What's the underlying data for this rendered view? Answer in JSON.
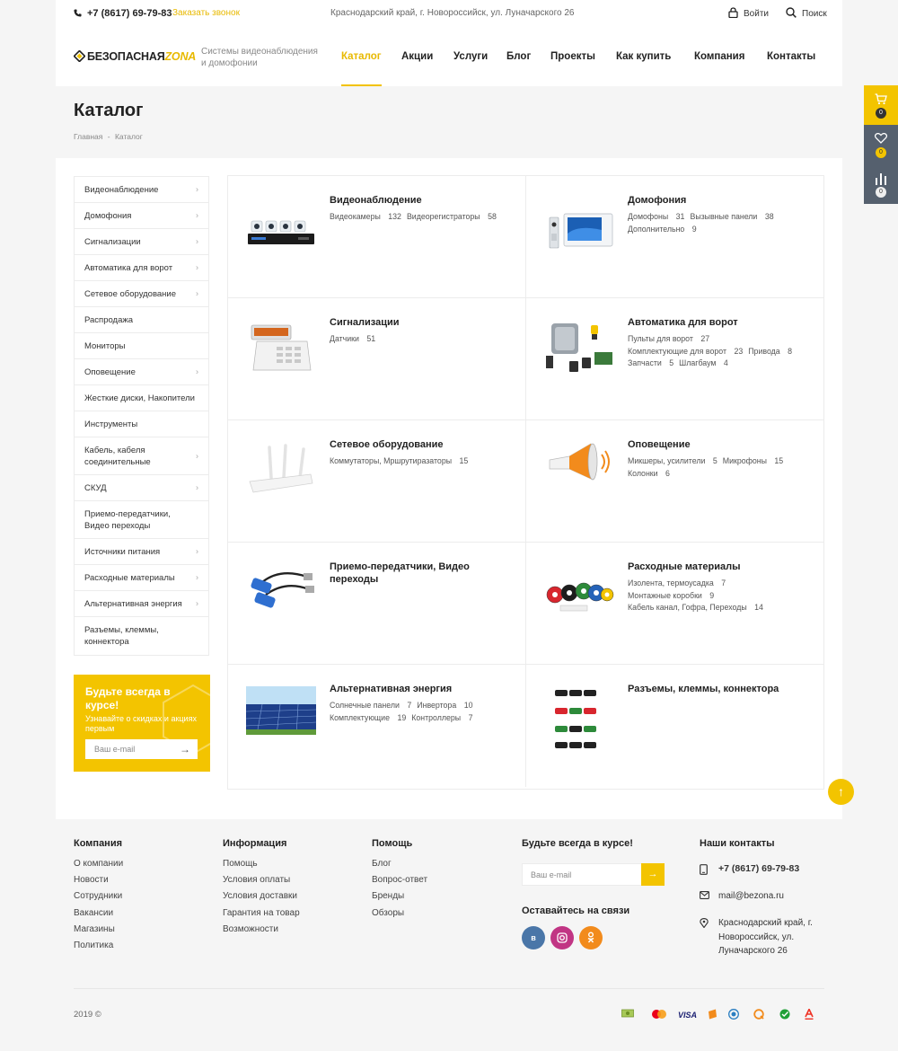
{
  "topbar": {
    "phone": "+7 (8617) 69-79-83",
    "callback": "Заказать звонок",
    "address": "Краснодарский край, г. Новороссийск, ул. Луначарского 26",
    "login": "Войти",
    "search": "Поиск"
  },
  "header": {
    "logo_main": "БЕЗОПАСНАЯ",
    "logo_accent": "ZONA",
    "tagline": "Системы видеонаблюдения и домофонии",
    "nav": [
      "Каталог",
      "Акции",
      "Услуги",
      "Блог",
      "Проекты",
      "Как купить",
      "Компания",
      "Контакты"
    ],
    "active_nav": "Каталог"
  },
  "page": {
    "title": "Каталог",
    "breadcrumb_home": "Главная",
    "breadcrumb_sep": "-",
    "breadcrumb_current": "Каталог"
  },
  "sidebar": {
    "items": [
      {
        "label": "Видеонаблюдение",
        "has_children": true
      },
      {
        "label": "Домофония",
        "has_children": true
      },
      {
        "label": "Сигнализации",
        "has_children": true
      },
      {
        "label": "Автоматика для ворот",
        "has_children": true
      },
      {
        "label": "Сетевое оборудование",
        "has_children": true
      },
      {
        "label": "Распродажа",
        "has_children": false
      },
      {
        "label": "Мониторы",
        "has_children": false
      },
      {
        "label": "Оповещение",
        "has_children": true
      },
      {
        "label": "Жесткие диски, Накопители",
        "has_children": false
      },
      {
        "label": "Инструменты",
        "has_children": false
      },
      {
        "label": "Кабель, кабеля соединительные",
        "has_children": true
      },
      {
        "label": "СКУД",
        "has_children": true
      },
      {
        "label": "Приемо-передатчики, Видео переходы",
        "has_children": false
      },
      {
        "label": "Источники питания",
        "has_children": true
      },
      {
        "label": "Расходные материалы",
        "has_children": true
      },
      {
        "label": "Альтернативная энергия",
        "has_children": true
      },
      {
        "label": "Разъемы, клеммы, коннектора",
        "has_children": false
      }
    ]
  },
  "promo": {
    "title": "Будьте всегда в курсе!",
    "subtitle": "Узнавайте о скидках и акциях первым",
    "placeholder": "Ваш e-mail"
  },
  "categories": [
    {
      "title": "Видеонаблюдение",
      "icon": "dvr-cameras-image",
      "lines": [
        [
          {
            "name": "Видеокамеры",
            "count": "132"
          },
          {
            "name": "Видеорегистраторы",
            "count": "58"
          }
        ]
      ]
    },
    {
      "title": "Домофония",
      "icon": "intercom-image",
      "lines": [
        [
          {
            "name": "Домофоны",
            "count": "31"
          },
          {
            "name": "Вызывные панели",
            "count": "38"
          }
        ],
        [
          {
            "name": "Дополнительно",
            "count": "9"
          }
        ]
      ]
    },
    {
      "title": "Сигнализации",
      "icon": "alarm-panel-image",
      "lines": [
        [
          {
            "name": "Датчики",
            "count": "51"
          }
        ]
      ]
    },
    {
      "title": "Автоматика для ворот",
      "icon": "gate-automation-image",
      "lines": [
        [
          {
            "name": "Пульты для ворот",
            "count": "27"
          }
        ],
        [
          {
            "name": "Комплектующие для ворот",
            "count": "23"
          },
          {
            "name": "Привода",
            "count": "8"
          }
        ],
        [
          {
            "name": "Запчасти",
            "count": "5"
          },
          {
            "name": "Шлагбаум",
            "count": "4"
          }
        ]
      ]
    },
    {
      "title": "Сетевое оборудование",
      "icon": "router-image",
      "lines": [
        [
          {
            "name": "Коммутаторы, Мршрутиразаторы",
            "count": "15"
          }
        ]
      ]
    },
    {
      "title": "Оповещение",
      "icon": "megaphone-image",
      "lines": [
        [
          {
            "name": "Микшеры, усилители",
            "count": "5"
          },
          {
            "name": "Микрофоны",
            "count": "15"
          }
        ],
        [
          {
            "name": "Колонки",
            "count": "6"
          }
        ]
      ]
    },
    {
      "title": "Приемо-передатчики, Видео переходы",
      "icon": "video-balun-image",
      "lines": []
    },
    {
      "title": "Расходные материалы",
      "icon": "tape-rolls-image",
      "lines": [
        [
          {
            "name": "Изолента, термоусадка",
            "count": "7"
          }
        ],
        [
          {
            "name": "Монтажные коробки",
            "count": "9"
          }
        ],
        [
          {
            "name": "Кабель канал, Гофра, Переходы",
            "count": "14"
          }
        ]
      ]
    },
    {
      "title": "Альтернативная энергия",
      "icon": "solar-panel-image",
      "lines": [
        [
          {
            "name": "Солнечные панели",
            "count": "7"
          },
          {
            "name": "Инвертора",
            "count": "10"
          }
        ],
        [
          {
            "name": "Комплектующие",
            "count": "19"
          },
          {
            "name": "Контроллеры",
            "count": "7"
          }
        ]
      ]
    },
    {
      "title": "Разъемы, клеммы, коннектора",
      "icon": "connectors-image",
      "lines": []
    }
  ],
  "floatbar": {
    "cart_count": "0",
    "favorites_count": "0",
    "compare_count": "0"
  },
  "footer": {
    "col1_title": "Компания",
    "col1_links": [
      "О компании",
      "Новости",
      "Сотрудники",
      "Вакансии",
      "Магазины",
      "Политика"
    ],
    "col2_title": "Информация",
    "col2_links": [
      "Помощь",
      "Условия оплаты",
      "Условия доставки",
      "Гарантия на товар",
      "Возможности"
    ],
    "col3_title": "Помощь",
    "col3_links": [
      "Блог",
      "Вопрос-ответ",
      "Бренды",
      "Обзоры"
    ],
    "subscribe_title": "Будьте всегда в курсе!",
    "subscribe_placeholder": "Ваш e-mail",
    "social_title": "Оставайтесь на связи",
    "social": [
      {
        "label": "в",
        "color": "#4a76a8"
      },
      {
        "label": "ig",
        "color": "#c13584"
      },
      {
        "label": "ok",
        "color": "#f28b1c"
      }
    ],
    "contacts_title": "Наши контакты",
    "contact_phone": "+7 (8617) 69-79-83",
    "contact_email": "mail@bezona.ru",
    "contact_address": "Краснодарский край, г. Новороссийск, ул. Луначарского 26",
    "copyright": "2019 ©",
    "visa_label": "VISA"
  },
  "colors": {
    "accent": "#f3c400",
    "dark_panel": "#55606e"
  }
}
